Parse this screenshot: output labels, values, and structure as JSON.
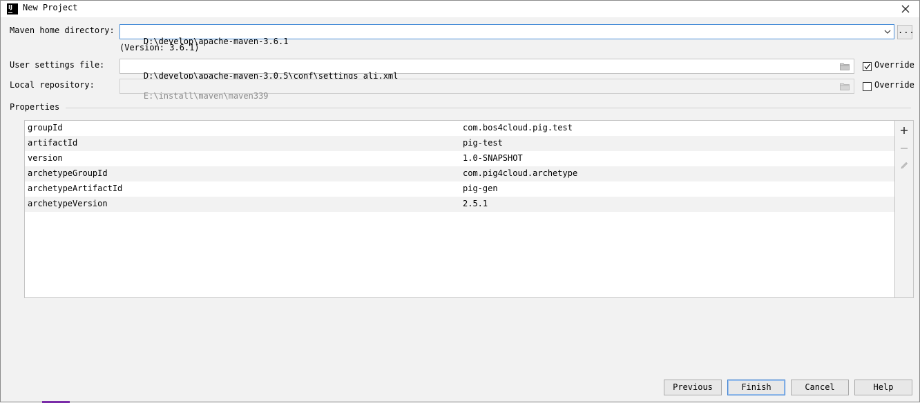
{
  "window": {
    "title": "New Project"
  },
  "maven": {
    "home_label": "Maven home directory:",
    "home_value": "D:\\develop\\apache-maven-3.6.1",
    "version_text": "(Version: 3.6.1)",
    "browse_label": "...",
    "settings_label": "User settings file:",
    "settings_value": "D:\\develop\\apache-maven-3.0.5\\conf\\settings_ali.xml",
    "settings_override_label": "Override",
    "settings_override_checked": true,
    "repo_label": "Local repository:",
    "repo_value": "E:\\install\\maven\\maven339",
    "repo_override_label": "Override",
    "repo_override_checked": false
  },
  "properties": {
    "title": "Properties",
    "rows": [
      {
        "key": "groupId",
        "value": "com.bos4cloud.pig.test"
      },
      {
        "key": "artifactId",
        "value": "pig-test"
      },
      {
        "key": "version",
        "value": "1.0-SNAPSHOT"
      },
      {
        "key": "archetypeGroupId",
        "value": "com.pig4cloud.archetype"
      },
      {
        "key": "archetypeArtifactId",
        "value": "pig-gen"
      },
      {
        "key": "archetypeVersion",
        "value": "2.5.1"
      }
    ],
    "toolbar": [
      "plus-icon",
      "minus-icon",
      "pencil-icon"
    ]
  },
  "buttons": {
    "previous": "Previous",
    "finish": "Finish",
    "cancel": "Cancel",
    "help": "Help"
  },
  "colors": {
    "focus_border": "#4a8fd8",
    "default_button_border": "#3c7fd1"
  }
}
